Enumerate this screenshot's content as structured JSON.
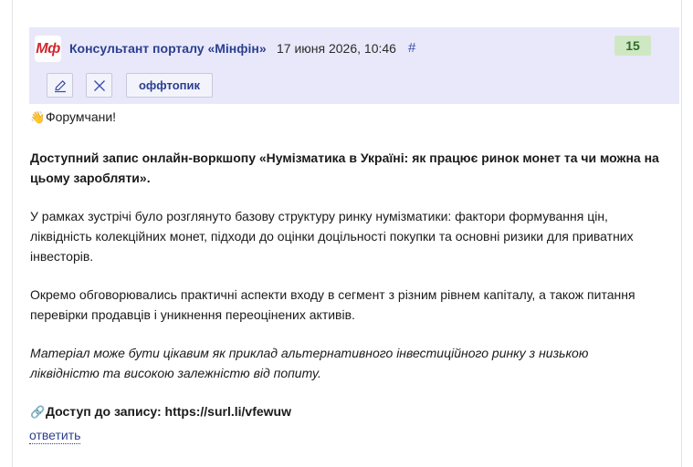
{
  "post": {
    "logo_text": "Мф",
    "author": "Консультант порталу «Мінфін»",
    "date": "17 июня 2026, 10:46",
    "permalink": "#",
    "score": "15",
    "actions": {
      "offtopic_label": "оффтопик"
    },
    "body": {
      "greeting_emoji": "👋",
      "greeting": "Форумчани!",
      "headline": "Доступний запис онлайн-воркшопу «Нумізматика в Україні: як працює ринок монет та чи можна на цьому заробляти».",
      "paragraph1": "У рамках зустрічі було розглянуто базову структуру ринку нумізматики: фактори формування цін, ліквідність колекційних монет, підходи до оцінки доцільності покупки та основні ризики для приватних інвесторів.",
      "paragraph2": "Окремо обговорювались практичні аспекти входу в сегмент з різним рівнем капіталу, а також питання перевірки продавців і уникнення переоцінених активів.",
      "note": "Матеріал може бути цікавим як приклад альтернативного інвестиційного ринку з низькою ліквідністю та високою залежністю від попиту.",
      "link_emoji": "🔗",
      "link_text": "Доступ до запису: https://surl.li/vfewuw"
    },
    "reply_label": "ответить"
  },
  "colors": {
    "header_bg": "#e8e8fa",
    "author": "#2b3f8f",
    "score_bg": "#cfe8c3",
    "score_text": "#2d6b2a",
    "logo": "#d0282e"
  }
}
